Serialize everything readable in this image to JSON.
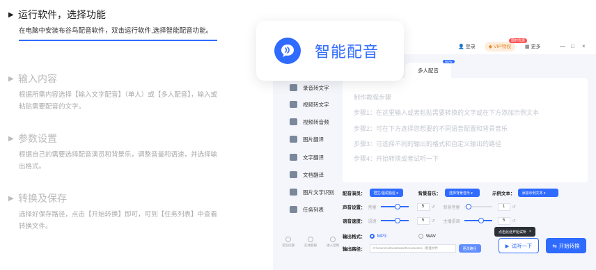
{
  "steps": [
    {
      "title": "运行软件，选择功能",
      "desc": "在电脑中安装布谷鸟配音软件，双击运行软件,选择智能配音功能。"
    },
    {
      "title": "输入内容",
      "desc": "根据所需内容选择【输入文字配音】（单人）或【多人配音】，输入或粘贴需要配音的文字。"
    },
    {
      "title": "参数设置",
      "desc": "根据自己的需要选择配音演员和背景乐，调整音量和语速，并选择输出格式。"
    },
    {
      "title": "转换及保存",
      "desc": "选择好保存路径，点击【开始转换】即可，可到【任务列表】中查看转换文件。"
    }
  ],
  "card": {
    "title": "智能配音",
    "logo_icon": "voice-bubble-icon"
  },
  "titlebar": {
    "login": "登录",
    "vip": "VIP特权",
    "vip_badge": "限时优惠",
    "more": "更多",
    "minimize": "—",
    "maximize": "□",
    "close": "×"
  },
  "tabs": {
    "multi": "多人配音",
    "multi_badge": "NEW"
  },
  "sidebar": {
    "items": [
      "录音转文字",
      "视频转文字",
      "视频转音频",
      "图片翻译",
      "文字翻译",
      "文档翻译",
      "图片文字识别",
      "任务列表"
    ],
    "footer": [
      "常见问题",
      "在线客服",
      "进入官网"
    ]
  },
  "textarea": {
    "lines": [
      "制作教程步骤",
      "步骤1：在这里输入或者粘贴需要转换的文字或在下方添加示例文本",
      "步骤2：可在下方选择您想要的不同语音配置和背景音乐",
      "步骤3：可选择不同的输出的格式和自定义输出的路径",
      "步骤4：开始转换或者试听一下"
    ]
  },
  "settings": {
    "actor_label": "配音演员：",
    "actor_value": "君生/温润独遥 ▾",
    "bgm_label": "背景音乐：",
    "bgm_value": "选择背景音乐 ▾",
    "sample_label": "示例文本：",
    "sample_value": "添加示例文本 ▾",
    "volume_label": "声音设置：",
    "volume_sub": "音量",
    "volume_value": "5",
    "bg_volume_sub": "背景音量",
    "bg_volume_value": "1",
    "speed_label": "语音速度：",
    "speed_sub": "语速",
    "speed_value": "5",
    "pitch_sub": "主播语调",
    "pitch_value": "5",
    "format_label": "输出格式：",
    "format_mp3": "MP3",
    "format_wav": "WAV",
    "path_label": "输出路径：",
    "path_value": "C:\\Users\\Administrator\\Documents\\...\\智能文件",
    "path_button": "更改路径"
  },
  "tooltip": {
    "text": "点击此处开始试听",
    "close": "×"
  },
  "buttons": {
    "trial": "试听一下",
    "start": "开始转换"
  },
  "colors": {
    "accent": "#2f6bff"
  }
}
